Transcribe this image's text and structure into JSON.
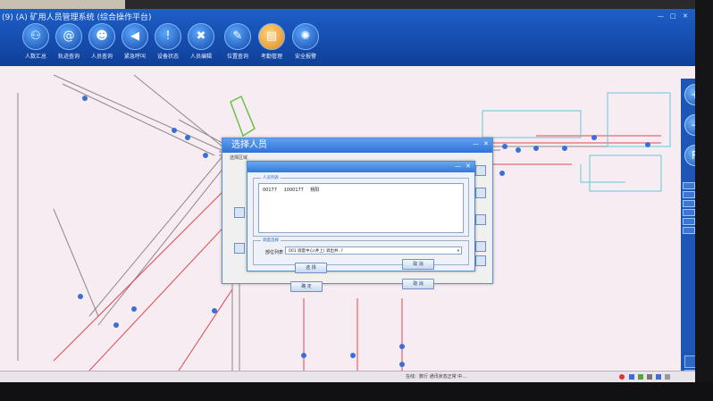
{
  "window": {
    "title": "(9) (A) 矿用人员管理系统 (综合操作平台)",
    "controls": [
      "—",
      "□",
      "✕"
    ]
  },
  "toolbar": [
    {
      "label": "人数汇总",
      "icon": "person-sum-icon",
      "glyph": "⚇"
    },
    {
      "label": "轨迹查询",
      "icon": "at-icon",
      "glyph": "@"
    },
    {
      "label": "人员查询",
      "icon": "people-icon",
      "glyph": "☻"
    },
    {
      "label": "紧急呼叫",
      "icon": "speaker-icon",
      "glyph": "◀"
    },
    {
      "label": "设备状态",
      "icon": "info-icon",
      "glyph": "!"
    },
    {
      "label": "人员编辑",
      "icon": "tools-icon",
      "glyph": "✖"
    },
    {
      "label": "位置查询",
      "icon": "pen-icon",
      "glyph": "✎"
    },
    {
      "label": "考勤管理",
      "icon": "folder-icon",
      "glyph": "▤"
    },
    {
      "label": "安全报警",
      "icon": "alarm-icon",
      "glyph": "✺"
    }
  ],
  "side_nav": {
    "zoom_in": "+",
    "zoom_out": "−",
    "reset": "R"
  },
  "outer_dialog": {
    "title": "选择人员",
    "subtitle": "选择区域",
    "ok_label": "确 定",
    "cancel_label": "取 消"
  },
  "inner_dialog": {
    "group_people": "人员列表",
    "rows": [
      {
        "card": "00177",
        "id": "1000177",
        "name": "杨阳"
      }
    ],
    "group_select": "调度选择",
    "select_label": "部位列表",
    "select_value": "001  调度中心(井上)  调出井..?",
    "select_button": "选 择",
    "cancel_button": "取 消"
  },
  "status_bar": {
    "text": "在线：数行    通讯状态正常    中..."
  },
  "colors": {
    "titlebar": "#1d5fc8",
    "map_bg": "#f6ecf2",
    "dialog_title": "#2f73d6"
  }
}
